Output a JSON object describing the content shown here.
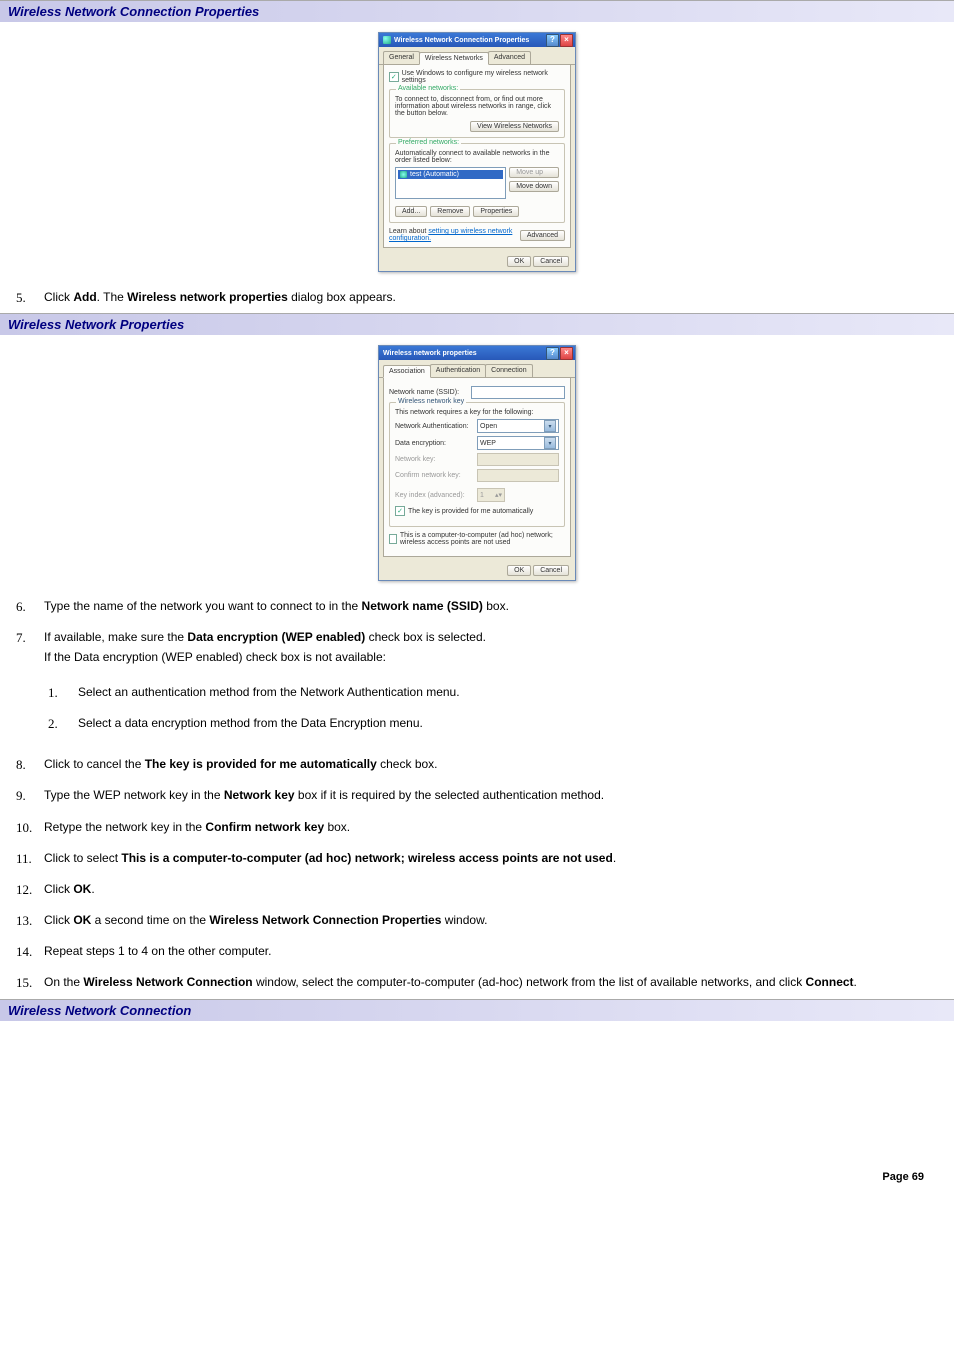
{
  "headers": {
    "h1": "Wireless Network Connection Properties",
    "h2": "Wireless Network Properties",
    "h3": "Wireless Network Connection"
  },
  "dlg1": {
    "title": "Wireless Network Connection Properties",
    "tabs": {
      "general": "General",
      "wireless": "Wireless Networks",
      "advanced": "Advanced"
    },
    "use_windows": "Use Windows to configure my wireless network settings",
    "available_legend": "Available networks:",
    "available_text": "To connect to, disconnect from, or find out more information about wireless networks in range, click the button below.",
    "view_btn": "View Wireless Networks",
    "preferred_legend": "Preferred networks:",
    "preferred_text": "Automatically connect to available networks in the order listed below:",
    "item": "test (Automatic)",
    "moveup": "Move up",
    "movedown": "Move down",
    "add": "Add...",
    "remove": "Remove",
    "properties": "Properties",
    "learn_pre": "Learn about ",
    "learn_link": "setting up wireless network configuration.",
    "advanced_btn": "Advanced",
    "ok": "OK",
    "cancel": "Cancel"
  },
  "dlg2": {
    "title": "Wireless network properties",
    "tabs": {
      "assoc": "Association",
      "auth": "Authentication",
      "conn": "Connection"
    },
    "ssid_label": "Network name (SSID):",
    "key_legend": "Wireless network key",
    "key_text": "This network requires a key for the following:",
    "auth_label": "Network Authentication:",
    "auth_val": "Open",
    "enc_label": "Data encryption:",
    "enc_val": "WEP",
    "netkey_label": "Network key:",
    "confkey_label": "Confirm network key:",
    "keyidx_label": "Key index (advanced):",
    "keyidx_val": "1",
    "auto_key": "The key is provided for me automatically",
    "adhoc": "This is a computer-to-computer (ad hoc) network; wireless access points are not used",
    "ok": "OK",
    "cancel": "Cancel"
  },
  "steps": {
    "s5a": "Click ",
    "s5b": "Add",
    "s5c": ". The ",
    "s5d": "Wireless network properties",
    "s5e": " dialog box appears.",
    "s6a": "Type the name of the network you want to connect to in the ",
    "s6b": "Network name (SSID)",
    "s6c": " box.",
    "s7a": "If available, make sure the ",
    "s7b": "Data encryption (WEP enabled)",
    "s7c": " check box is selected.",
    "s7d": "If the Data encryption (WEP enabled) check box is not available:",
    "s7_1": "Select an authentication method from the Network Authentication menu.",
    "s7_2": "Select a data encryption method from the Data Encryption menu.",
    "s8a": "Click to cancel the ",
    "s8b": "The key is provided for me automatically",
    "s8c": " check box.",
    "s9a": "Type the WEP network key in the ",
    "s9b": "Network key",
    "s9c": " box if it is required by the selected authentication method.",
    "s10a": "Retype the network key in the ",
    "s10b": "Confirm network key",
    "s10c": " box.",
    "s11a": "Click to select ",
    "s11b": "This is a computer-to-computer (ad hoc) network; wireless access points are not used",
    "s11c": ".",
    "s12a": "Click ",
    "s12b": "OK",
    "s12c": ".",
    "s13a": "Click ",
    "s13b": "OK",
    "s13c": " a second time on the ",
    "s13d": "Wireless Network Connection Properties",
    "s13e": " window.",
    "s14": "Repeat steps 1 to 4 on the other computer.",
    "s15a": "On the ",
    "s15b": "Wireless Network Connection",
    "s15c": " window, select the computer-to-computer (ad-hoc) network from the list of available networks, and click ",
    "s15d": "Connect",
    "s15e": "."
  },
  "nums": {
    "n5": "5.",
    "n6": "6.",
    "n7": "7.",
    "n8": "8.",
    "n9": "9.",
    "n10": "10.",
    "n11": "11.",
    "n12": "12.",
    "n13": "13.",
    "n14": "14.",
    "n15": "15.",
    "sn1": "1.",
    "sn2": "2."
  },
  "page": "Page 69"
}
